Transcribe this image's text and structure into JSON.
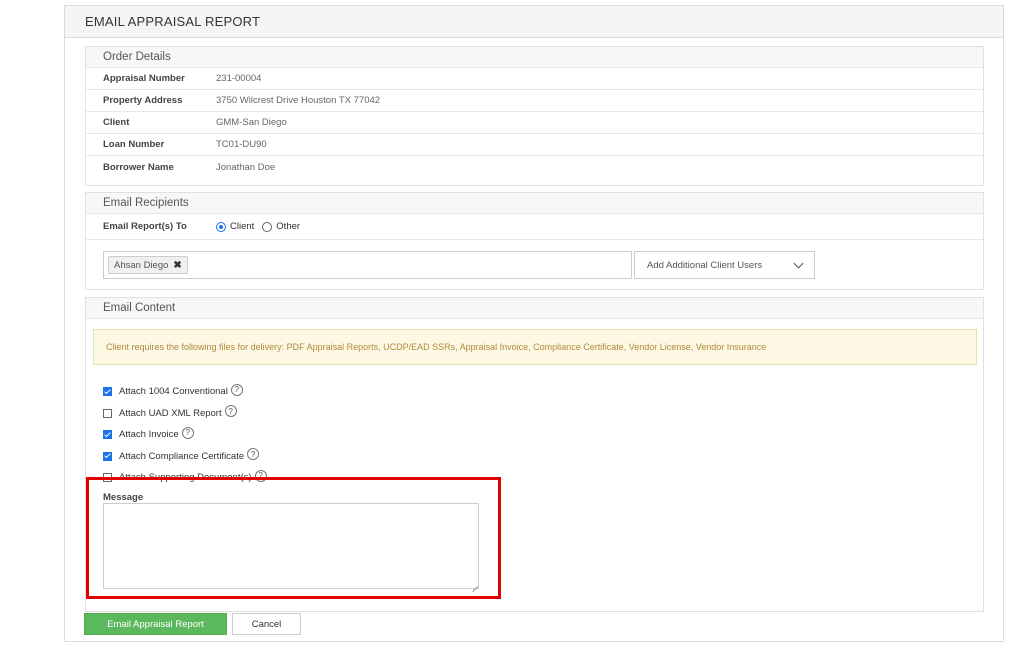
{
  "page": {
    "title": "EMAIL APPRAISAL REPORT"
  },
  "order_details": {
    "title": "Order Details",
    "rows": [
      {
        "label": "Appraisal Number",
        "value": "231-00004"
      },
      {
        "label": "Property Address",
        "value": "3750 Wilcrest Drive Houston TX 77042"
      },
      {
        "label": "Client",
        "value": "GMM-San Diego"
      },
      {
        "label": "Loan Number",
        "value": "TC01-DU90"
      },
      {
        "label": "Borrower Name",
        "value": "Jonathan Doe"
      }
    ]
  },
  "recipients": {
    "title": "Email Recipients",
    "email_to_label": "Email Report(s) To",
    "radio_client": "Client",
    "radio_other": "Other",
    "selected": "Client",
    "tag_name": "Ahsan Diego",
    "tag_remove": "✖",
    "select_placeholder": "Add Additional Client Users"
  },
  "content": {
    "title": "Email Content",
    "alert": "Client requires the following files for delivery: PDF Appraisal Reports, UCDP/EAD SSRs, Appraisal Invoice, Compliance Certificate, Vendor License, Vendor Insurance",
    "checks": [
      {
        "label": "Attach 1004 Conventional",
        "checked": true
      },
      {
        "label": "Attach UAD XML Report",
        "checked": false
      },
      {
        "label": "Attach Invoice",
        "checked": true
      },
      {
        "label": "Attach Compliance Certificate",
        "checked": true
      },
      {
        "label": "Attach Supporting Document(s)",
        "checked": false
      }
    ],
    "help_glyph": "?",
    "message_label": "Message",
    "message_value": ""
  },
  "actions": {
    "submit_label": "Email Appraisal Report",
    "cancel_label": "Cancel"
  },
  "colors": {
    "primary": "#5cb85c",
    "accent": "#1a73e8",
    "highlight": "#e00000",
    "alert_bg": "#fcf8e3"
  }
}
